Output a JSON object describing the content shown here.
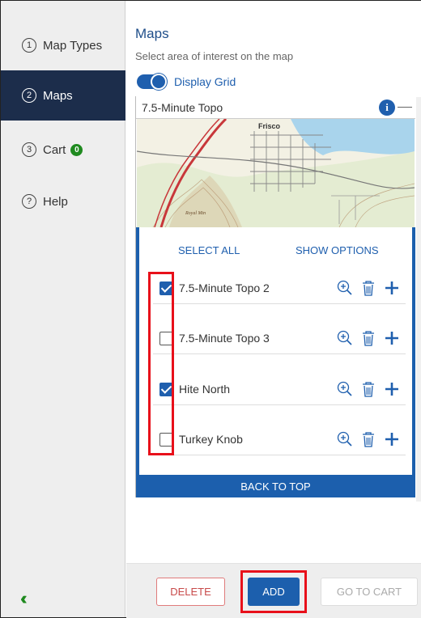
{
  "sidebar": {
    "items": [
      {
        "num": "1",
        "label": "Map Types",
        "active": false
      },
      {
        "num": "2",
        "label": "Maps",
        "active": true
      },
      {
        "num": "3",
        "label": "Cart",
        "active": false,
        "badge": "0"
      },
      {
        "num": "?",
        "label": "Help",
        "active": false
      }
    ],
    "collapse_icon": "double-chevron-left-icon"
  },
  "main": {
    "title": "Maps",
    "subtitle": "Select area of interest on the map",
    "display_grid_label": "Display Grid",
    "display_grid_on": true
  },
  "panel": {
    "title": "7.5-Minute Topo",
    "info_glyph": "i",
    "map_labels": [
      "Frisco",
      "Royal Mtn"
    ],
    "select_all": "SELECT ALL",
    "show_options": "SHOW OPTIONS",
    "rows": [
      {
        "label": "7.5-Minute Topo 2",
        "checked": true
      },
      {
        "label": "7.5-Minute Topo 3",
        "checked": false
      },
      {
        "label": "Hite North",
        "checked": true
      },
      {
        "label": "Turkey Knob",
        "checked": false
      }
    ],
    "back_to_top": "BACK TO TOP"
  },
  "footer": {
    "delete": "DELETE",
    "add": "ADD",
    "go_to_cart": "GO TO CART"
  },
  "colors": {
    "accent": "#1f5fae",
    "nav_active": "#1c2d4b",
    "highlight": "#e8101a",
    "badge": "#1f8a1f"
  }
}
